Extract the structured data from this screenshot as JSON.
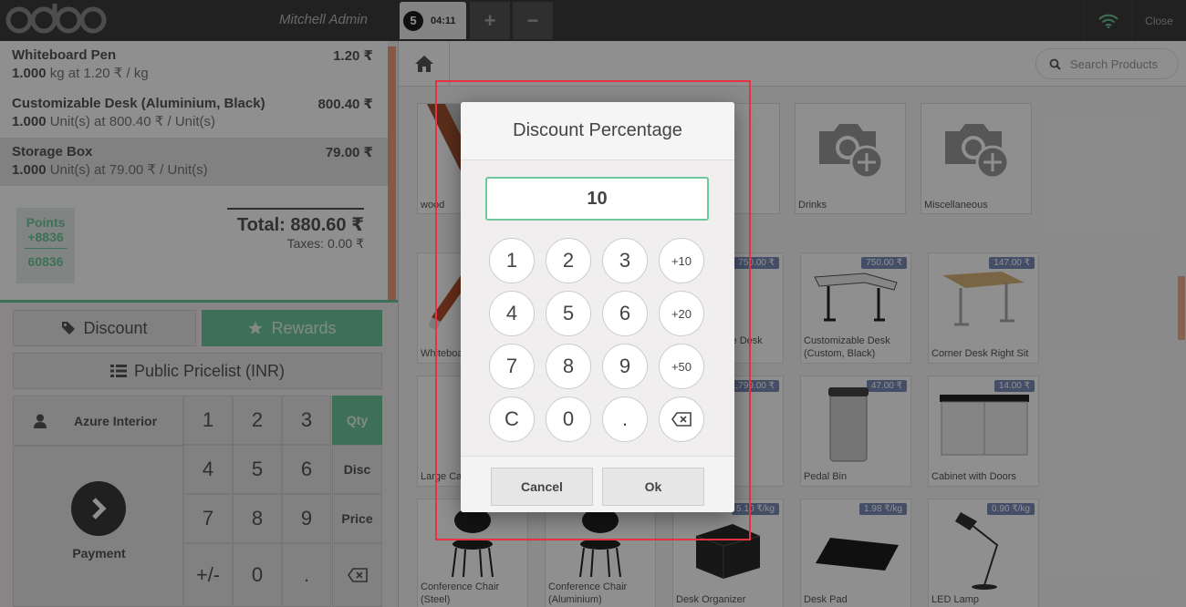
{
  "header": {
    "user_name": "Mitchell Admin",
    "order_number": "5",
    "order_time": "04:11",
    "add_order": "+",
    "remove_order": "−",
    "close_label": "Close"
  },
  "order": {
    "lines": [
      {
        "name": "Whiteboard Pen",
        "price": "1.20 ₹",
        "qty": "1.000",
        "info": "kg at 1.20 ₹ / kg"
      },
      {
        "name": "Customizable Desk (Aluminium, Black)",
        "price": "800.40 ₹",
        "qty": "1.000",
        "info": "Unit(s) at 800.40 ₹ / Unit(s)"
      },
      {
        "name": "Storage Box",
        "price": "79.00 ₹",
        "qty": "1.000",
        "info": "Unit(s) at 79.00 ₹ / Unit(s)"
      }
    ],
    "points_label": "Points",
    "points_won": "+8836",
    "points_total": "60836",
    "total": "Total: 880.60 ₹",
    "taxes": "Taxes: 0.00 ₹"
  },
  "controls": {
    "discount": "Discount",
    "rewards": "Rewards",
    "pricelist": "Public Pricelist (INR)",
    "customer": "Azure Interior",
    "payment": "Payment"
  },
  "numpad": {
    "keys": [
      "1",
      "2",
      "3",
      "4",
      "5",
      "6",
      "7",
      "8",
      "9",
      "+/-",
      "0",
      "."
    ],
    "qty": "Qty",
    "disc": "Disc",
    "price": "Price"
  },
  "search": {
    "placeholder": "Search Products"
  },
  "categories": [
    {
      "label": "wood"
    },
    {
      "label": ""
    },
    {
      "label": ""
    },
    {
      "label": "Drinks"
    },
    {
      "label": "Miscellaneous"
    }
  ],
  "products": [
    {
      "name": "Whiteboard Pen",
      "tag": ""
    },
    {
      "name": "",
      "tag": ""
    },
    {
      "name": "Customizable Desk (White)",
      "tag": "750.00 ₹"
    },
    {
      "name": "Customizable Desk (Custom, Black)",
      "tag": "750.00 ₹"
    },
    {
      "name": "Corner Desk Right Sit",
      "tag": "147.00 ₹"
    },
    {
      "name": "Large Cabinet",
      "tag": ""
    },
    {
      "name": "",
      "tag": ""
    },
    {
      "name": "",
      "tag": "1,799.00 ₹"
    },
    {
      "name": "Pedal Bin",
      "tag": "47.00 ₹"
    },
    {
      "name": "Cabinet with Doors",
      "tag": "14.00 ₹"
    },
    {
      "name": "Conference Chair (Steel)",
      "tag": ""
    },
    {
      "name": "Conference Chair (Aluminium)",
      "tag": ""
    },
    {
      "name": "Desk Organizer",
      "tag": "5.10 ₹/kg"
    },
    {
      "name": "Desk Pad",
      "tag": "1.98 ₹/kg"
    },
    {
      "name": "LED Lamp",
      "tag": "0.90 ₹/kg"
    }
  ],
  "popup": {
    "title": "Discount Percentage",
    "value": "10",
    "keys": [
      "1",
      "2",
      "3",
      "+10",
      "4",
      "5",
      "6",
      "+20",
      "7",
      "8",
      "9",
      "+50",
      "C",
      "0",
      "."
    ],
    "cancel": "Cancel",
    "ok": "Ok"
  },
  "colors": {
    "accent": "#6ec89b",
    "frame": "#e53344",
    "topbar": "#3b3b3b"
  }
}
